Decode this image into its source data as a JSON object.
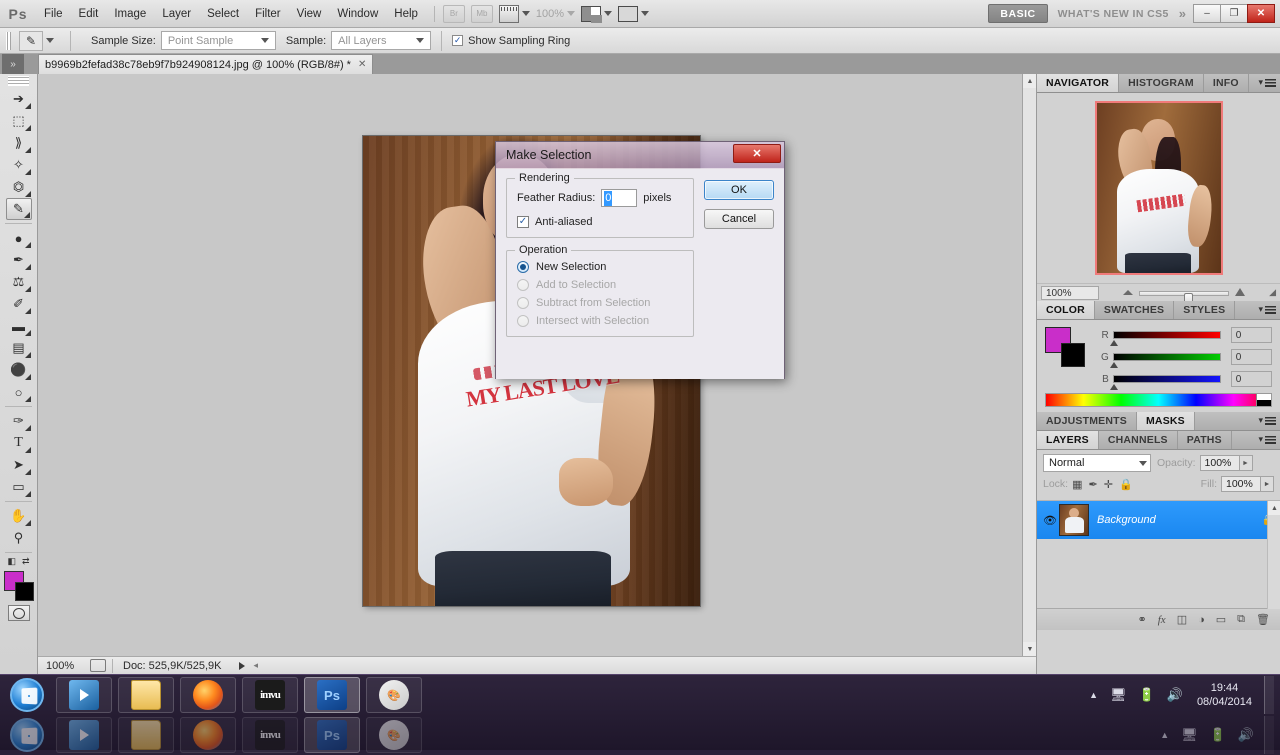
{
  "app": {
    "logo": "Ps",
    "menus": [
      "File",
      "Edit",
      "Image",
      "Layer",
      "Select",
      "Filter",
      "View",
      "Window",
      "Help"
    ],
    "quick_icons": [
      "Br",
      "Mb"
    ],
    "zoom_level": "100%",
    "workspace_button": "BASIC",
    "whats_new": "WHAT'S NEW IN CS5",
    "chevron": "»",
    "window_buttons": {
      "minimize": "–",
      "restore": "❐",
      "close": "✕"
    }
  },
  "options_bar": {
    "tool_icon": "eyedropper-icon",
    "sample_size_label": "Sample Size:",
    "sample_size_value": "Point Sample",
    "sample_label": "Sample:",
    "sample_value": "All Layers",
    "show_sampling_ring_label": "Show Sampling Ring",
    "show_sampling_ring_checked": true,
    "check_glyph": "✓"
  },
  "document": {
    "tab_title": "b9969b2fefad38c78eb9f7b924908124.jpg @ 100% (RGB/8#) *",
    "close_glyph": "✕",
    "collapse_glyph": "»",
    "shirt_text": "MY LAST LOVE"
  },
  "toolbox": {
    "tools": [
      {
        "name": "move-tool",
        "glyph": "↖",
        "active": false
      },
      {
        "name": "rectangular-marquee-tool",
        "glyph": "⬚",
        "active": false
      },
      {
        "name": "lasso-tool",
        "glyph": "⧫",
        "active": false
      },
      {
        "name": "magic-wand-tool",
        "glyph": "✨",
        "active": false
      },
      {
        "name": "crop-tool",
        "glyph": "⛏",
        "active": false
      },
      {
        "name": "eyedropper-tool",
        "glyph": "✐",
        "active": true
      },
      {
        "name": "spot-healing-brush-tool",
        "glyph": "◐",
        "active": false
      },
      {
        "name": "brush-tool",
        "glyph": "✒",
        "active": false
      },
      {
        "name": "clone-stamp-tool",
        "glyph": "⚓",
        "active": false
      },
      {
        "name": "history-brush-tool",
        "glyph": "✎",
        "active": false
      },
      {
        "name": "eraser-tool",
        "glyph": "▰",
        "active": false
      },
      {
        "name": "gradient-tool",
        "glyph": "▤",
        "active": false
      },
      {
        "name": "blur-tool",
        "glyph": "●",
        "active": false
      },
      {
        "name": "dodge-tool",
        "glyph": "○",
        "active": false
      },
      {
        "name": "pen-tool",
        "glyph": "✑",
        "active": false
      },
      {
        "name": "type-tool",
        "glyph": "T",
        "active": false
      },
      {
        "name": "path-selection-tool",
        "glyph": "➤",
        "active": false
      },
      {
        "name": "rectangle-tool",
        "glyph": "▭",
        "active": false
      },
      {
        "name": "hand-tool",
        "glyph": "✋",
        "active": false
      },
      {
        "name": "zoom-tool",
        "glyph": "⚲",
        "active": false
      }
    ],
    "foreground_color": "#c92ec9",
    "background_color": "#000000",
    "swap_glyph": "⇄",
    "default_glyph": "◧"
  },
  "dialog": {
    "title": "Make Selection",
    "close_glyph": "✕",
    "rendering_legend": "Rendering",
    "feather_label": "Feather Radius:",
    "feather_value": "0",
    "feather_unit": "pixels",
    "antialiased_label": "Anti-aliased",
    "antialiased_checked": true,
    "check_glyph": "✓",
    "operation_legend": "Operation",
    "operations": [
      {
        "label": "New Selection",
        "selected": true,
        "disabled": false
      },
      {
        "label": "Add to Selection",
        "selected": false,
        "disabled": true
      },
      {
        "label": "Subtract from Selection",
        "selected": false,
        "disabled": true
      },
      {
        "label": "Intersect with Selection",
        "selected": false,
        "disabled": true
      }
    ],
    "ok_label": "OK",
    "cancel_label": "Cancel"
  },
  "status_bar": {
    "zoom": "100%",
    "doc_info": "Doc: 525,9K/525,9K"
  },
  "navigator_panel": {
    "tabs": [
      "NAVIGATOR",
      "HISTOGRAM",
      "INFO"
    ],
    "active_tab": "NAVIGATOR",
    "zoom_value": "100%"
  },
  "color_panel": {
    "tabs": [
      "COLOR",
      "SWATCHES",
      "STYLES"
    ],
    "active_tab": "COLOR",
    "foreground_color": "#c92ec9",
    "background_color": "#000000",
    "channels": [
      {
        "label": "R",
        "value": "0"
      },
      {
        "label": "G",
        "value": "0"
      },
      {
        "label": "B",
        "value": "0"
      }
    ]
  },
  "adjustments_panel": {
    "tabs": [
      "ADJUSTMENTS",
      "MASKS"
    ],
    "active_tab": "MASKS"
  },
  "layers_panel": {
    "tabs": [
      "LAYERS",
      "CHANNELS",
      "PATHS"
    ],
    "active_tab": "LAYERS",
    "blend_mode": "Normal",
    "opacity_label": "Opacity:",
    "opacity_value": "100%",
    "lock_label": "Lock:",
    "fill_label": "Fill:",
    "fill_value": "100%",
    "lock_icons": [
      "▦",
      "✒",
      "✛",
      "ὑ2"
    ],
    "layers": [
      {
        "name": "Background",
        "visible": true,
        "locked": true,
        "selected": true
      }
    ],
    "eye_glyph": "◉",
    "lock_glyph": "ὑ2",
    "footer_icons": [
      "⚭",
      "fx",
      "▣",
      "◑",
      "▭",
      "⧉",
      "Ὕ1"
    ]
  },
  "taskbar": {
    "start_label": "Start",
    "buttons": [
      {
        "name": "windows-media-player",
        "label": "WMP"
      },
      {
        "name": "windows-explorer",
        "label": "Explorer"
      },
      {
        "name": "firefox",
        "label": "Firefox"
      },
      {
        "name": "imvu",
        "label": "imvu"
      },
      {
        "name": "photoshop",
        "label": "Ps",
        "active": true
      },
      {
        "name": "paint",
        "label": "Paint"
      }
    ],
    "tray": {
      "show_hidden_glyph": "▲",
      "network_glyph": "Ὓ3",
      "battery_glyph": "ὐb",
      "volume_glyph": "ὐa",
      "time": "19:44",
      "date": "08/04/2014"
    }
  }
}
